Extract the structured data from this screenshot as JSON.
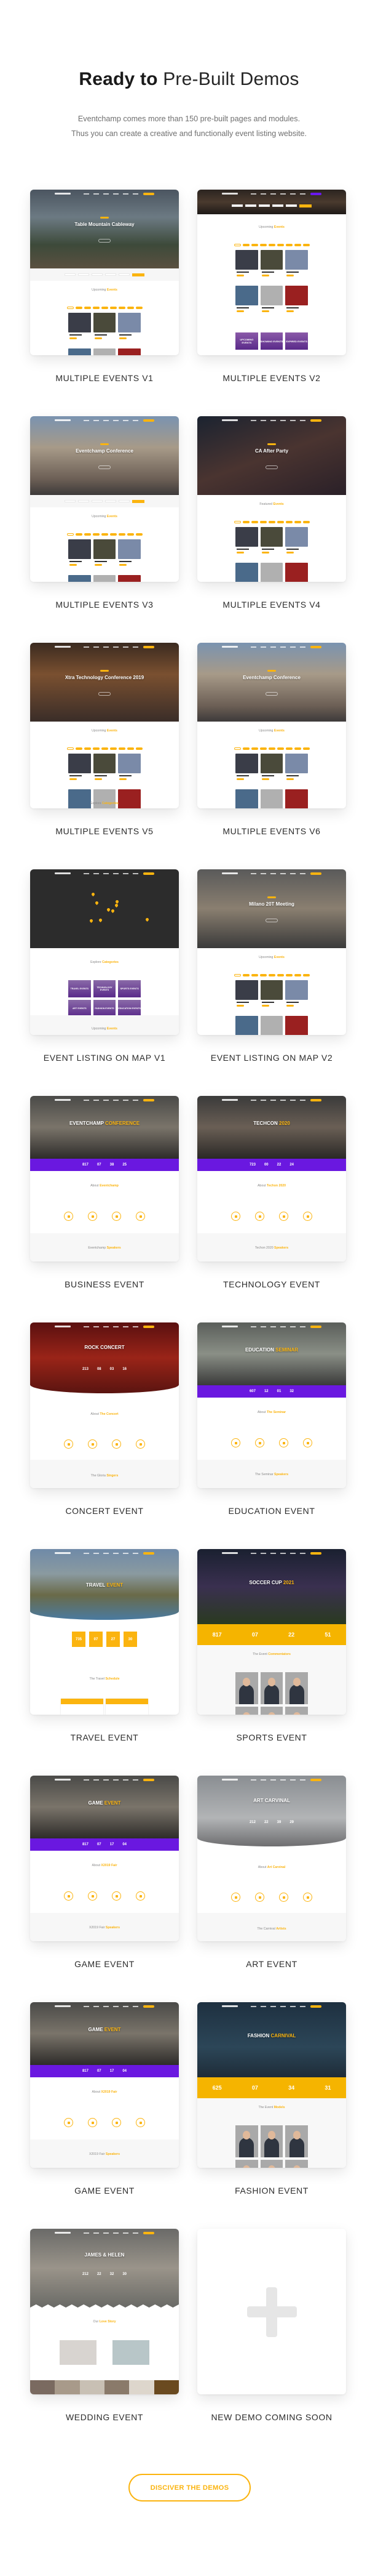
{
  "header": {
    "title_bold": "Ready to",
    "title_light": "Pre-Built Demos",
    "subtitle_line1": "Eventchamp comes more than 150 pre-built pages and modules.",
    "subtitle_line2": "Thus you can create a creative and functionally event listing website."
  },
  "colors": {
    "accent": "#fbb40f",
    "purple": "#6a18e0",
    "text_dark": "#1a1a1a",
    "text_muted": "#6f6f6f"
  },
  "demos": [
    {
      "label": "MULTIPLE EVENTS V1",
      "preview": {
        "kind": "listing",
        "hero_title": "Table Mountain Cableway",
        "hero_accent": "",
        "section_title": "Upcoming",
        "section_accent": "Events",
        "has_search": true
      }
    },
    {
      "label": "MULTIPLE EVENTS V2",
      "preview": {
        "kind": "listing-search",
        "hero_title": "",
        "hero_accent": "",
        "section_title": "Upcoming",
        "section_accent": "Events",
        "category_tiles": [
          "UPCOMING EVENTS",
          "SHOWING EVENTS",
          "EXPIRED EVENTS"
        ]
      }
    },
    {
      "label": "MULTIPLE EVENTS V3",
      "preview": {
        "kind": "listing",
        "hero_title": "Eventchamp Conference",
        "hero_accent": "",
        "section_title": "Upcoming",
        "section_accent": "Events",
        "has_search": true
      }
    },
    {
      "label": "MULTIPLE EVENTS V4",
      "preview": {
        "kind": "listing",
        "hero_title": "CA After Party",
        "hero_accent": "",
        "section_title": "Featured",
        "section_accent": "Events",
        "has_search": false
      }
    },
    {
      "label": "MULTIPLE EVENTS V5",
      "preview": {
        "kind": "listing",
        "hero_title": "Xtra Technology Conference 2019",
        "hero_accent": "",
        "section_title": "Upcoming",
        "section_accent": "Events",
        "secondary_title": "Explore",
        "secondary_accent": "Categories",
        "has_search": false
      }
    },
    {
      "label": "MULTIPLE EVENTS V6",
      "preview": {
        "kind": "listing",
        "hero_title": "Eventchamp Conference",
        "hero_accent": "",
        "section_title": "Upcoming",
        "section_accent": "Events",
        "has_search": false
      }
    },
    {
      "label": "EVENT LISTING ON MAP V1",
      "preview": {
        "kind": "map",
        "section_title": "Explore",
        "section_accent": "Categories",
        "secondary_title": "Upcoming",
        "secondary_accent": "Events",
        "category_tiles": [
          "TRAVEL EVENTS",
          "TECHNOLOGY EVENTS",
          "SPORTS EVENTS",
          "ART EVENTS",
          "FASHION EVENTS",
          "EDUCATION EVENTS"
        ]
      }
    },
    {
      "label": "EVENT LISTING ON MAP V2",
      "preview": {
        "kind": "listing",
        "hero_title": "Milano 20T Meeting",
        "hero_accent": "",
        "section_title": "Upcoming",
        "section_accent": "Events",
        "has_search": false
      }
    },
    {
      "label": "BUSINESS EVENT",
      "preview": {
        "kind": "single-purple",
        "hero_title": "EVENTCHAMP",
        "hero_accent": "CONFERENCE",
        "countdown": [
          "817",
          "07",
          "38",
          "25"
        ],
        "section_title": "About",
        "section_accent": "Eventchamp",
        "secondary_title": "Eventchamp",
        "secondary_accent": "Speakers"
      }
    },
    {
      "label": "TECHNOLOGY EVENT",
      "preview": {
        "kind": "single-purple",
        "hero_title": "TECHCON",
        "hero_accent": "2020",
        "countdown": [
          "723",
          "00",
          "22",
          "24"
        ],
        "section_title": "About",
        "section_accent": "Techon 2020",
        "secondary_title": "Techon 2020",
        "secondary_accent": "Speakers"
      }
    },
    {
      "label": "CONCERT EVENT",
      "preview": {
        "kind": "single-curve",
        "hero_title": "ROCK CONCERT",
        "hero_accent": "",
        "countdown": [
          "213",
          "08",
          "03",
          "16"
        ],
        "section_title": "About",
        "section_accent": "The Concert",
        "secondary_title": "The Gloria",
        "secondary_accent": "Singers"
      }
    },
    {
      "label": "EDUCATION EVENT",
      "preview": {
        "kind": "single-purple",
        "hero_title": "EDUCATION",
        "hero_accent": "SEMINAR",
        "countdown": [
          "607",
          "12",
          "01",
          "32"
        ],
        "section_title": "About",
        "section_accent": "The Seminar",
        "secondary_title": "The Seminar",
        "secondary_accent": "Speakers"
      }
    },
    {
      "label": "TRAVEL EVENT",
      "preview": {
        "kind": "travel",
        "hero_title": "TRAVEL",
        "hero_accent": "EVENT",
        "countdown": [
          "735",
          "07",
          "27",
          "30"
        ],
        "section_title": "The Travel",
        "section_accent": "Schedule"
      }
    },
    {
      "label": "SPORTS EVENT",
      "preview": {
        "kind": "single-yellow",
        "hero_title": "SOCCER CUP",
        "hero_accent": "2021",
        "countdown": [
          "817",
          "07",
          "22",
          "51"
        ],
        "section_title": "The Event",
        "section_accent": "Commentators"
      }
    },
    {
      "label": "GAME EVENT",
      "preview": {
        "kind": "single-purple",
        "hero_title": "GAME",
        "hero_accent": "EVENT",
        "countdown": [
          "817",
          "07",
          "17",
          "04"
        ],
        "section_title": "About",
        "section_accent": "X2019 Fair",
        "secondary_title": "X2019 Fair",
        "secondary_accent": "Speakers"
      }
    },
    {
      "label": "ART EVENT",
      "preview": {
        "kind": "single-curve",
        "hero_title": "ART CARVINAL",
        "hero_accent": "",
        "countdown": [
          "212",
          "22",
          "39",
          "29"
        ],
        "section_title": "About",
        "section_accent": "Art Carvinal",
        "secondary_title": "The Carnival",
        "secondary_accent": "Artists"
      }
    },
    {
      "label": "GAME EVENT",
      "preview": {
        "kind": "single-purple",
        "hero_title": "GAME",
        "hero_accent": "EVENT",
        "countdown": [
          "817",
          "07",
          "17",
          "04"
        ],
        "section_title": "About",
        "section_accent": "X2019 Fair",
        "secondary_title": "X2019 Fair",
        "secondary_accent": "Speakers"
      }
    },
    {
      "label": "FASHION EVENT",
      "preview": {
        "kind": "single-yellow",
        "hero_title": "FASHION",
        "hero_accent": "CARNIVAL",
        "countdown": [
          "625",
          "07",
          "34",
          "31"
        ],
        "section_title": "The Event",
        "section_accent": "Models"
      }
    },
    {
      "label": "WEDDING EVENT",
      "preview": {
        "kind": "wedding",
        "hero_title": "JAMES & HELEN",
        "hero_accent": "",
        "countdown": [
          "212",
          "22",
          "32",
          "30"
        ],
        "section_title": "Our",
        "section_accent": "Love Story"
      }
    },
    {
      "label": "NEW DEMO COMING SOON",
      "preview": {
        "kind": "placeholder",
        "icon": "plus-icon"
      }
    }
  ],
  "cta": {
    "label": "DISCIVER THE DEMOS"
  }
}
